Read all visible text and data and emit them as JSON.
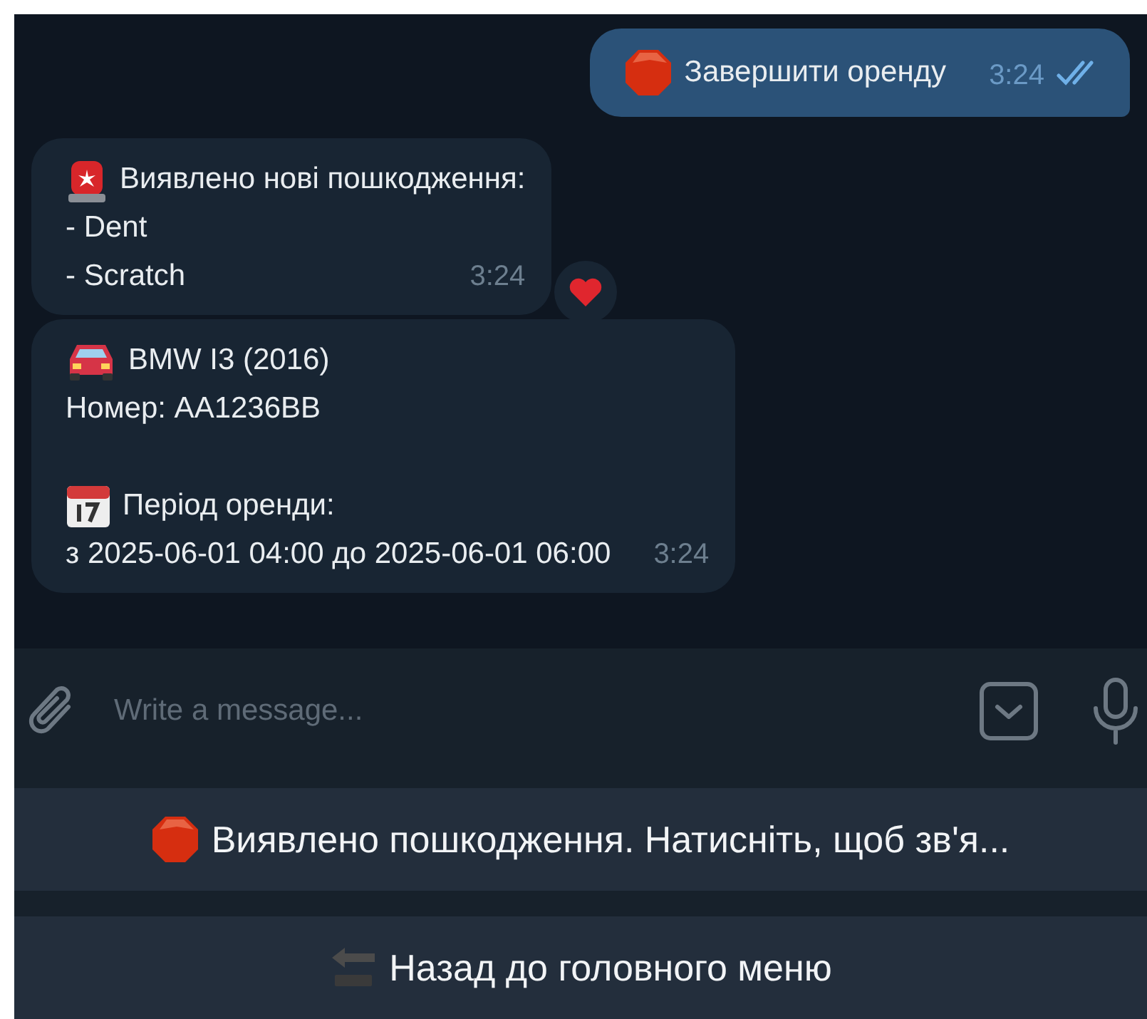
{
  "messages": [
    {
      "kind": "outgoing",
      "paragraphs": [
        [
          {
            "kind": "action",
            "text": "Завершити оренду"
          }
        ]
      ],
      "time": "3:24",
      "read": true
    },
    {
      "kind": "incoming",
      "paragraphs": [
        [
          {
            "kind": "alert",
            "text": "Виявлено нові пошкодження:"
          },
          {
            "kind": "item",
            "text": "- Dent"
          },
          {
            "kind": "item",
            "text": "- Scratch"
          }
        ]
      ],
      "time": "3:24",
      "reacted": true
    },
    {
      "kind": "incoming",
      "paragraphs": [
        [
          {
            "kind": "vehicle",
            "text": "BMW I3 (2016)"
          },
          {
            "kind": "item",
            "text": "Номер: AA1236BB"
          }
        ],
        [
          {
            "kind": "period",
            "text": "Період оренди:"
          },
          {
            "kind": "item",
            "text": "з 2025-06-01 04:00 до 2025-06-01 06:00"
          }
        ]
      ],
      "time": "3:24"
    }
  ],
  "composer": {
    "placeholder": "Write a message..."
  },
  "keyboard": [
    {
      "kind": "report",
      "label": "Виявлено пошкодження. Натисніть, щоб зв'я..."
    },
    {
      "kind": "back",
      "label": "Назад до головного меню"
    }
  ]
}
